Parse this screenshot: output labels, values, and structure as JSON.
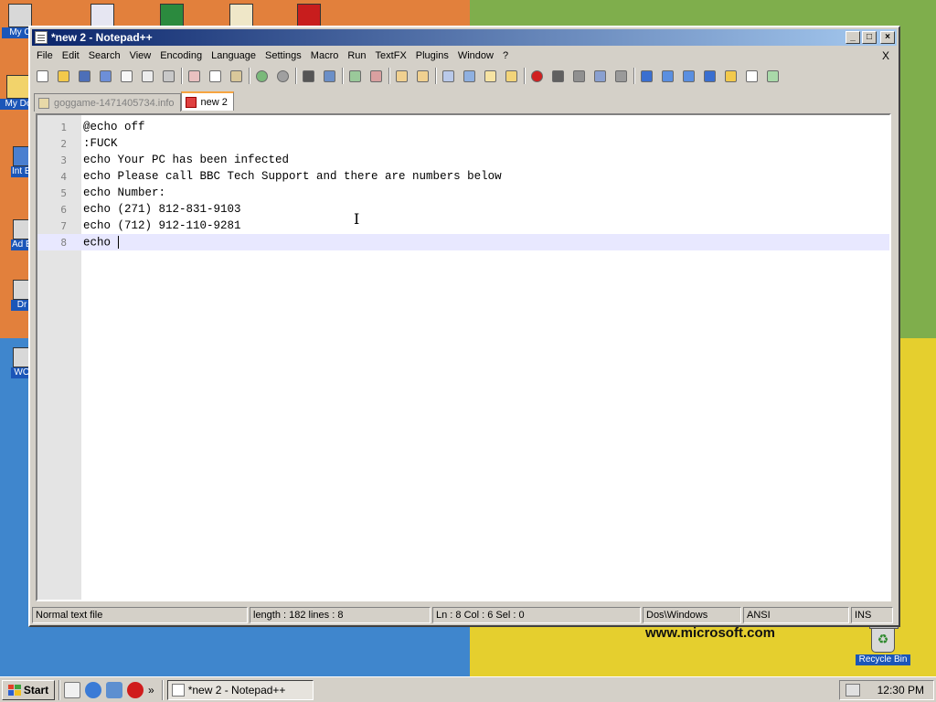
{
  "desktop": {
    "icons": [
      {
        "label": "My C"
      },
      {
        "label": "My Do"
      },
      {
        "label": "Int Exp"
      },
      {
        "label": "Ad Em"
      },
      {
        "label": "Dr"
      },
      {
        "label": "WO"
      }
    ],
    "logo_text": "www.microsoft.com",
    "recycle_bin_label": "Recycle Bin"
  },
  "window": {
    "title": "*new  2 - Notepad++",
    "menu": [
      {
        "label": "File"
      },
      {
        "label": "Edit"
      },
      {
        "label": "Search"
      },
      {
        "label": "View"
      },
      {
        "label": "Encoding"
      },
      {
        "label": "Language"
      },
      {
        "label": "Settings"
      },
      {
        "label": "Macro"
      },
      {
        "label": "Run"
      },
      {
        "label": "TextFX"
      },
      {
        "label": "Plugins"
      },
      {
        "label": "Window"
      },
      {
        "label": "?"
      }
    ],
    "menu_close": "X",
    "tabs": [
      {
        "label": "goggame-1471405734.info",
        "active": false
      },
      {
        "label": "new  2",
        "active": true
      }
    ],
    "editor": {
      "lines": [
        {
          "num": "1",
          "text": "@echo off"
        },
        {
          "num": "2",
          "text": ":FUCK"
        },
        {
          "num": "3",
          "text": "echo Your PC has been infected"
        },
        {
          "num": "4",
          "text": "echo Please call BBC Tech Support and there are numbers below"
        },
        {
          "num": "5",
          "text": "echo Number:"
        },
        {
          "num": "6",
          "text": "echo (271) 812-831-9103"
        },
        {
          "num": "7",
          "text": "echo (712) 912-110-9281"
        },
        {
          "num": "8",
          "text": "echo "
        }
      ]
    },
    "status": {
      "file_type": "Normal text file",
      "length_lines": "length : 182    lines : 8",
      "position": "Ln : 8    Col : 6    Sel : 0",
      "eol": "Dos\\Windows",
      "encoding": "ANSI",
      "mode": "INS"
    }
  },
  "taskbar": {
    "start_label": "Start",
    "task_label": "*new  2 - Notepad++",
    "overflow": "»",
    "clock": "12:30 PM"
  }
}
